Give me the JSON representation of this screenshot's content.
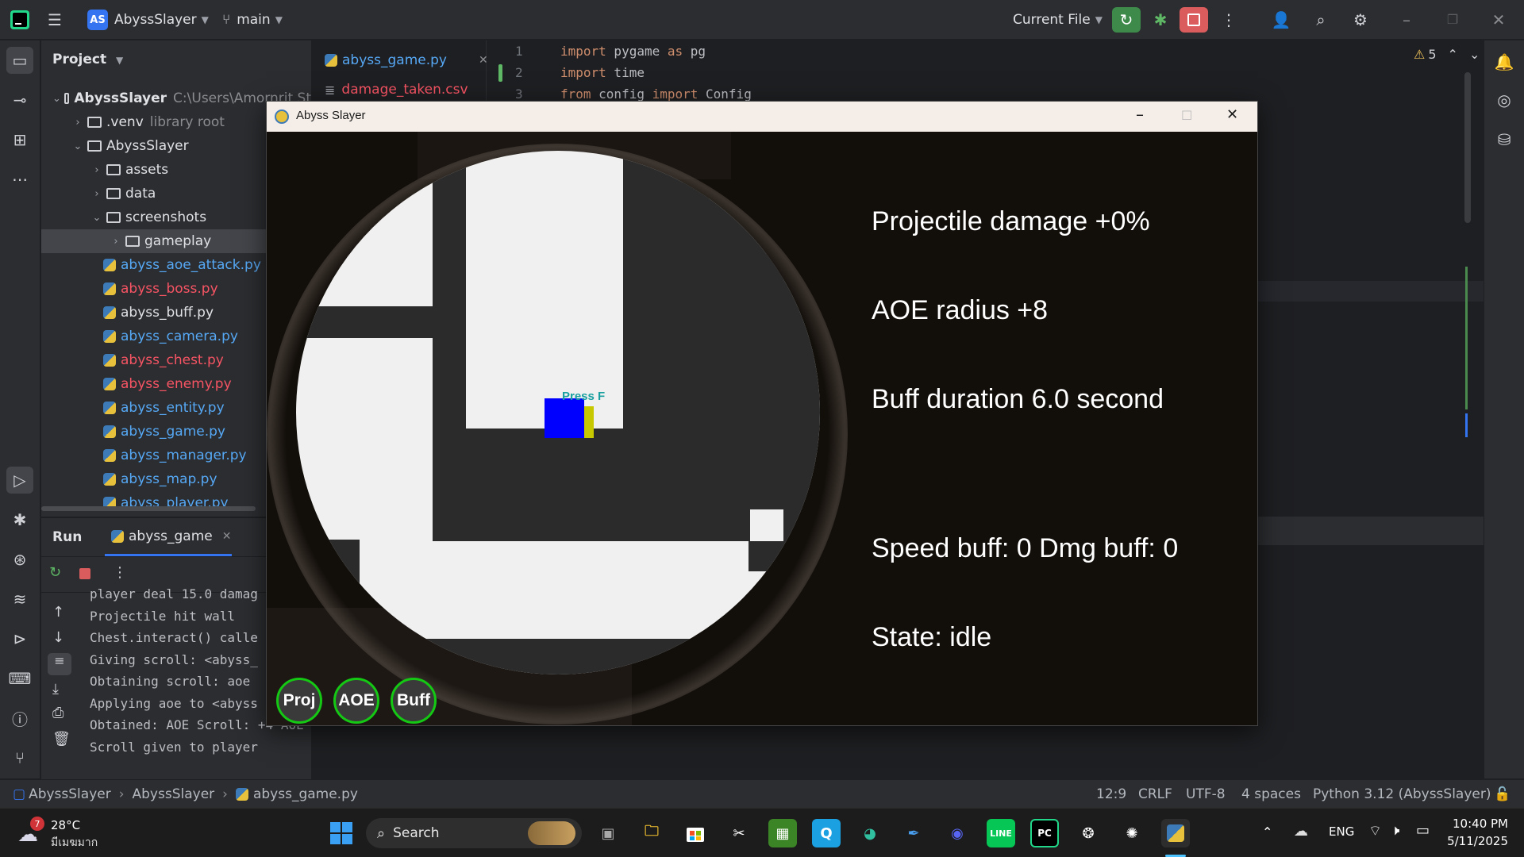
{
  "titlebar": {
    "project_badge": "AS",
    "project_name": "AbyssSlayer",
    "branch": "main",
    "run_config": "Current File"
  },
  "project_panel": {
    "title": "Project",
    "root": {
      "name": "AbyssSlayer",
      "path": "C:\\Users\\Amornrit St"
    },
    "items": [
      {
        "name": ".venv",
        "suffix": "library root",
        "type": "folder",
        "expanded": false,
        "depth": 1
      },
      {
        "name": "AbyssSlayer",
        "type": "folder",
        "expanded": true,
        "depth": 1
      },
      {
        "name": "assets",
        "type": "folder",
        "expanded": false,
        "depth": 2
      },
      {
        "name": "data",
        "type": "folder",
        "expanded": false,
        "depth": 2
      },
      {
        "name": "screenshots",
        "type": "folder",
        "expanded": true,
        "depth": 2
      },
      {
        "name": "gameplay",
        "type": "folder",
        "expanded": false,
        "depth": 3,
        "selected": true
      },
      {
        "name": "abyss_aoe_attack.py",
        "type": "py",
        "depth": 2,
        "color": "#56a8f5"
      },
      {
        "name": "abyss_boss.py",
        "type": "py",
        "depth": 2,
        "color": "#f75464"
      },
      {
        "name": "abyss_buff.py",
        "type": "py",
        "depth": 2,
        "color": "#dfe1e5"
      },
      {
        "name": "abyss_camera.py",
        "type": "py",
        "depth": 2,
        "color": "#56a8f5"
      },
      {
        "name": "abyss_chest.py",
        "type": "py",
        "depth": 2,
        "color": "#f75464"
      },
      {
        "name": "abyss_enemy.py",
        "type": "py",
        "depth": 2,
        "color": "#f75464"
      },
      {
        "name": "abyss_entity.py",
        "type": "py",
        "depth": 2,
        "color": "#56a8f5"
      },
      {
        "name": "abyss_game.py",
        "type": "py",
        "depth": 2,
        "color": "#56a8f5"
      },
      {
        "name": "abyss_manager.py",
        "type": "py",
        "depth": 2,
        "color": "#56a8f5"
      },
      {
        "name": "abyss_map.py",
        "type": "py",
        "depth": 2,
        "color": "#56a8f5"
      },
      {
        "name": "abyss_player.py",
        "type": "py",
        "depth": 2,
        "color": "#56a8f5"
      }
    ]
  },
  "editor": {
    "tabs": [
      {
        "label": "abyss_game.py",
        "active": true
      },
      {
        "label": "damage_taken.csv",
        "active": false
      }
    ],
    "lines": [
      {
        "num": "1",
        "parts": [
          {
            "t": "import",
            "k": true
          },
          {
            "t": " pygame ",
            "k": false
          },
          {
            "t": "as",
            "k": true
          },
          {
            "t": " pg",
            "k": false
          }
        ]
      },
      {
        "num": "2",
        "parts": [
          {
            "t": "import",
            "k": true
          },
          {
            "t": " time",
            "k": false
          }
        ]
      },
      {
        "num": "3",
        "parts": [
          {
            "t": "from",
            "k": true
          },
          {
            "t": " config ",
            "k": false
          },
          {
            "t": "import",
            "k": true
          },
          {
            "t": " Config",
            "k": false
          }
        ]
      }
    ],
    "warnings": "5"
  },
  "run_panel": {
    "tab_run": "Run",
    "tab_config": "abyss_game",
    "console": [
      "player deal 15.0 damag",
      "Projectile hit wall",
      "Chest.interact() calle",
      "Giving scroll: <abyss_",
      "Obtaining scroll: aoe",
      "Applying aoe to <abyss",
      "Obtained: AOE Scroll: +4 AOE radius",
      "Scroll given to player"
    ]
  },
  "game_window": {
    "title": "Abyss Slayer",
    "hud": {
      "projectile": "Projectile damage +0%",
      "aoe": "AOE radius +8",
      "buff": "Buff duration 6.0 second",
      "buffs": "Speed buff: 0 Dmg buff: 0",
      "state": "State: idle"
    },
    "prompt": "Press F",
    "skills": [
      "Proj",
      "AOE",
      "Buff"
    ],
    "colors": {
      "player": "#0000ff",
      "chest": "#c8c800",
      "prompt": "#1aa0a0",
      "skill_ring": "#14c814"
    }
  },
  "statusbar": {
    "crumbs": [
      "AbyssSlayer",
      "AbyssSlayer",
      "abyss_game.py"
    ],
    "position": "12:9",
    "line_sep": "CRLF",
    "encoding": "UTF-8",
    "indent": "4 spaces",
    "interpreter": "Python 3.12 (AbyssSlayer)"
  },
  "taskbar": {
    "weather_temp": "28°C",
    "weather_desc": "มีเมฆมาก",
    "weather_badge": "7",
    "search_label": "Search",
    "lang": "ENG",
    "time": "10:40 PM",
    "date": "5/11/2025"
  }
}
